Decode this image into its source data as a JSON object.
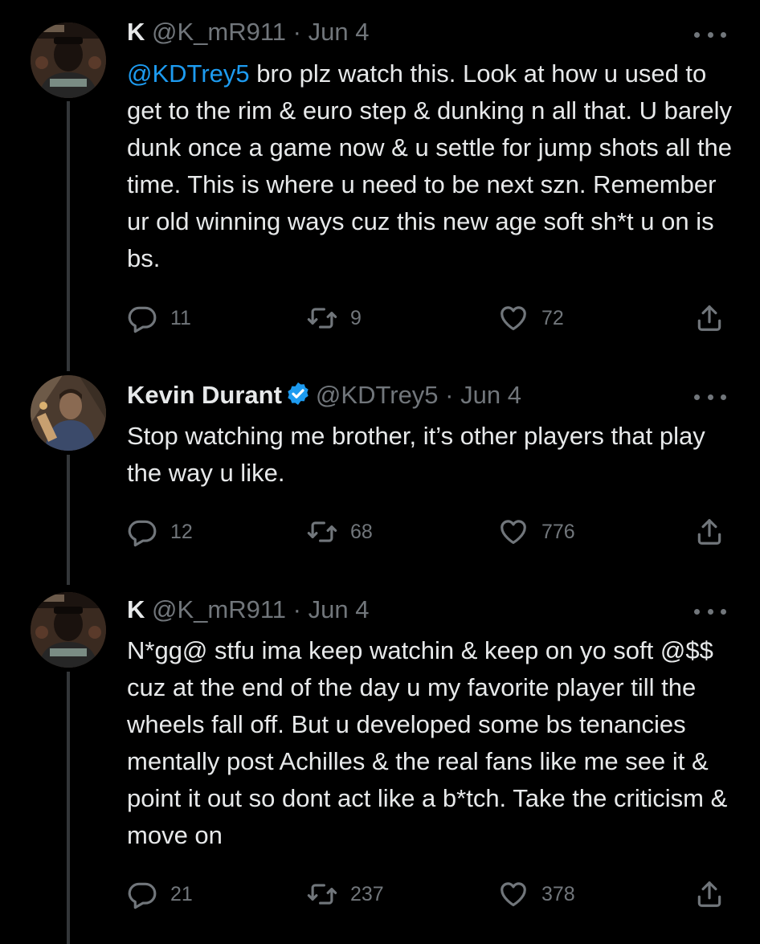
{
  "tweets": [
    {
      "name": "K",
      "handle": "@K_mR911",
      "sep": "·",
      "date": "Jun 4",
      "mention": "@KDTrey5",
      "text_after": " bro plz watch this. Look at how u used to get to the rim & euro step & dunking n all that. U barely dunk once a game now & u settle for jump shots all the time. This is where u need to be next szn. Remember ur old winning ways cuz this new age soft sh*t u on is bs.",
      "replies": "11",
      "retweets": "9",
      "likes": "72",
      "avatar_icon": "user-avatar"
    },
    {
      "name": "Kevin Durant",
      "handle": "@KDTrey5",
      "sep": "·",
      "date": "Jun 4",
      "verified_icon": "verified-badge-icon",
      "text": "Stop watching me brother, it’s other players that play the way u like.",
      "replies": "12",
      "retweets": "68",
      "likes": "776",
      "avatar_icon": "user-avatar"
    },
    {
      "name": "K",
      "handle": "@K_mR911",
      "sep": "·",
      "date": "Jun 4",
      "text": "N*gg@ stfu ima keep watchin & keep on yo soft @$$ cuz at the end of the day u my favorite player till the wheels fall off. But u developed some bs tenancies mentally post Achilles & the real fans like me see it & point it out so dont act like a b*tch. Take the criticism & move on",
      "replies": "21",
      "retweets": "237",
      "likes": "378",
      "avatar_icon": "user-avatar"
    }
  ],
  "colors": {
    "background": "#000000",
    "text": "#e7e9ea",
    "secondary": "#71767b",
    "link": "#1d9bf0",
    "thread_line": "#333639"
  }
}
